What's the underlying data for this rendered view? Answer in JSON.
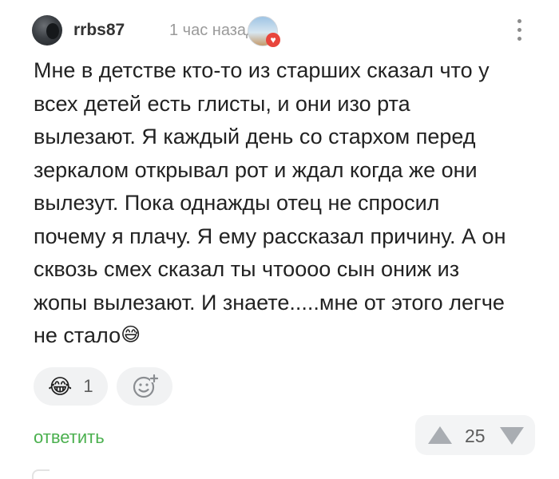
{
  "comment": {
    "author": "rrbs87",
    "time": "1 час назад",
    "avatar_icon": "user-avatar",
    "badge_icon": "award-badge",
    "text": "Мне в детстве кто-то из старших сказал что у\nвсех детей есть глисты, и они изо рта\nвылезают. Я каждый день со стархом перед\nзеркалом открывал рот и ждал когда же они\nвылезут. Пока однажды отец не спросил\nпочему я плачу. Я ему рассказал причину. А он\nсквозь смех сказал ты чтоооо сын ониж из\nжопы вылезают. И знаете.....мне от этого легче\nне стало",
    "text_emoji": "😅"
  },
  "reactions": {
    "laugh_emoji": "😂",
    "laugh_count": "1",
    "add_reaction_icon": "add-emoji-icon"
  },
  "actions": {
    "reply_label": "ответить",
    "rating": "25"
  },
  "colors": {
    "reply_green": "#4bb04f",
    "muted_gray": "#9a9a9a",
    "chip_bg": "#f1f2f3"
  }
}
